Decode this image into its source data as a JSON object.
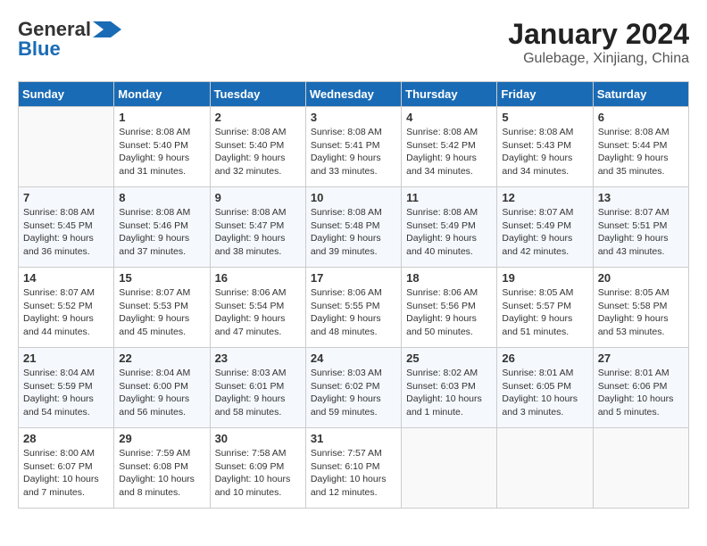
{
  "logo": {
    "line1": "General",
    "line2": "Blue"
  },
  "title": {
    "month_year": "January 2024",
    "location": "Gulebage, Xinjiang, China"
  },
  "days_of_week": [
    "Sunday",
    "Monday",
    "Tuesday",
    "Wednesday",
    "Thursday",
    "Friday",
    "Saturday"
  ],
  "weeks": [
    [
      {
        "day": "",
        "info": ""
      },
      {
        "day": "1",
        "info": "Sunrise: 8:08 AM\nSunset: 5:40 PM\nDaylight: 9 hours\nand 31 minutes."
      },
      {
        "day": "2",
        "info": "Sunrise: 8:08 AM\nSunset: 5:40 PM\nDaylight: 9 hours\nand 32 minutes."
      },
      {
        "day": "3",
        "info": "Sunrise: 8:08 AM\nSunset: 5:41 PM\nDaylight: 9 hours\nand 33 minutes."
      },
      {
        "day": "4",
        "info": "Sunrise: 8:08 AM\nSunset: 5:42 PM\nDaylight: 9 hours\nand 34 minutes."
      },
      {
        "day": "5",
        "info": "Sunrise: 8:08 AM\nSunset: 5:43 PM\nDaylight: 9 hours\nand 34 minutes."
      },
      {
        "day": "6",
        "info": "Sunrise: 8:08 AM\nSunset: 5:44 PM\nDaylight: 9 hours\nand 35 minutes."
      }
    ],
    [
      {
        "day": "7",
        "info": "Sunrise: 8:08 AM\nSunset: 5:45 PM\nDaylight: 9 hours\nand 36 minutes."
      },
      {
        "day": "8",
        "info": "Sunrise: 8:08 AM\nSunset: 5:46 PM\nDaylight: 9 hours\nand 37 minutes."
      },
      {
        "day": "9",
        "info": "Sunrise: 8:08 AM\nSunset: 5:47 PM\nDaylight: 9 hours\nand 38 minutes."
      },
      {
        "day": "10",
        "info": "Sunrise: 8:08 AM\nSunset: 5:48 PM\nDaylight: 9 hours\nand 39 minutes."
      },
      {
        "day": "11",
        "info": "Sunrise: 8:08 AM\nSunset: 5:49 PM\nDaylight: 9 hours\nand 40 minutes."
      },
      {
        "day": "12",
        "info": "Sunrise: 8:07 AM\nSunset: 5:49 PM\nDaylight: 9 hours\nand 42 minutes."
      },
      {
        "day": "13",
        "info": "Sunrise: 8:07 AM\nSunset: 5:51 PM\nDaylight: 9 hours\nand 43 minutes."
      }
    ],
    [
      {
        "day": "14",
        "info": "Sunrise: 8:07 AM\nSunset: 5:52 PM\nDaylight: 9 hours\nand 44 minutes."
      },
      {
        "day": "15",
        "info": "Sunrise: 8:07 AM\nSunset: 5:53 PM\nDaylight: 9 hours\nand 45 minutes."
      },
      {
        "day": "16",
        "info": "Sunrise: 8:06 AM\nSunset: 5:54 PM\nDaylight: 9 hours\nand 47 minutes."
      },
      {
        "day": "17",
        "info": "Sunrise: 8:06 AM\nSunset: 5:55 PM\nDaylight: 9 hours\nand 48 minutes."
      },
      {
        "day": "18",
        "info": "Sunrise: 8:06 AM\nSunset: 5:56 PM\nDaylight: 9 hours\nand 50 minutes."
      },
      {
        "day": "19",
        "info": "Sunrise: 8:05 AM\nSunset: 5:57 PM\nDaylight: 9 hours\nand 51 minutes."
      },
      {
        "day": "20",
        "info": "Sunrise: 8:05 AM\nSunset: 5:58 PM\nDaylight: 9 hours\nand 53 minutes."
      }
    ],
    [
      {
        "day": "21",
        "info": "Sunrise: 8:04 AM\nSunset: 5:59 PM\nDaylight: 9 hours\nand 54 minutes."
      },
      {
        "day": "22",
        "info": "Sunrise: 8:04 AM\nSunset: 6:00 PM\nDaylight: 9 hours\nand 56 minutes."
      },
      {
        "day": "23",
        "info": "Sunrise: 8:03 AM\nSunset: 6:01 PM\nDaylight: 9 hours\nand 58 minutes."
      },
      {
        "day": "24",
        "info": "Sunrise: 8:03 AM\nSunset: 6:02 PM\nDaylight: 9 hours\nand 59 minutes."
      },
      {
        "day": "25",
        "info": "Sunrise: 8:02 AM\nSunset: 6:03 PM\nDaylight: 10 hours\nand 1 minute."
      },
      {
        "day": "26",
        "info": "Sunrise: 8:01 AM\nSunset: 6:05 PM\nDaylight: 10 hours\nand 3 minutes."
      },
      {
        "day": "27",
        "info": "Sunrise: 8:01 AM\nSunset: 6:06 PM\nDaylight: 10 hours\nand 5 minutes."
      }
    ],
    [
      {
        "day": "28",
        "info": "Sunrise: 8:00 AM\nSunset: 6:07 PM\nDaylight: 10 hours\nand 7 minutes."
      },
      {
        "day": "29",
        "info": "Sunrise: 7:59 AM\nSunset: 6:08 PM\nDaylight: 10 hours\nand 8 minutes."
      },
      {
        "day": "30",
        "info": "Sunrise: 7:58 AM\nSunset: 6:09 PM\nDaylight: 10 hours\nand 10 minutes."
      },
      {
        "day": "31",
        "info": "Sunrise: 7:57 AM\nSunset: 6:10 PM\nDaylight: 10 hours\nand 12 minutes."
      },
      {
        "day": "",
        "info": ""
      },
      {
        "day": "",
        "info": ""
      },
      {
        "day": "",
        "info": ""
      }
    ]
  ]
}
